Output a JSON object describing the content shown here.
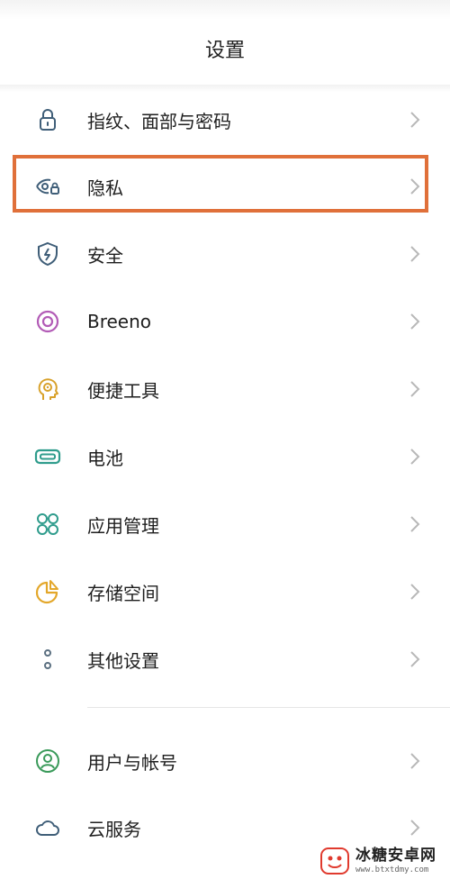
{
  "header": {
    "title": "设置"
  },
  "rows": [
    {
      "label": "指纹、面部与密码",
      "icon": "lock-icon"
    },
    {
      "label": "隐私",
      "icon": "privacy-eye-icon"
    },
    {
      "label": "安全",
      "icon": "security-shield-icon"
    },
    {
      "label": "Breeno",
      "icon": "breeno-ring-icon"
    },
    {
      "label": "便捷工具",
      "icon": "convenience-tools-icon"
    },
    {
      "label": "电池",
      "icon": "battery-icon"
    },
    {
      "label": "应用管理",
      "icon": "apps-grid-icon"
    },
    {
      "label": "存储空间",
      "icon": "storage-pie-icon"
    },
    {
      "label": "其他设置",
      "icon": "other-settings-icon"
    },
    {
      "label": "用户与帐号",
      "icon": "user-account-icon"
    },
    {
      "label": "云服务",
      "icon": "cloud-icon"
    }
  ],
  "watermark": {
    "title": "冰糖安卓网",
    "url": "www.btxtdmy.com"
  },
  "colors": {
    "highlight": "#e0703a",
    "chevron": "#b8b8b8"
  }
}
